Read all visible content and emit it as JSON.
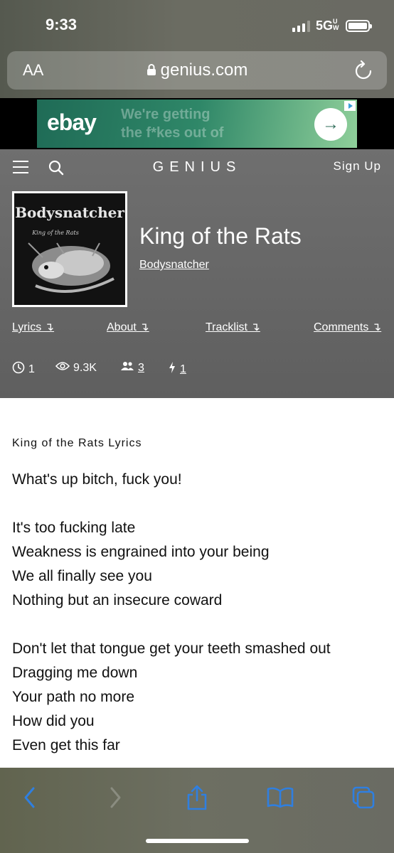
{
  "status_bar": {
    "time": "9:33",
    "network": "5G",
    "network_suffix": "UW"
  },
  "url_bar": {
    "text_size_label": "AA",
    "url": "genius.com"
  },
  "ad": {
    "logo": "ebay",
    "text_line1": "We're getting",
    "text_line2": "the f*kes out of",
    "arrow": "→"
  },
  "header": {
    "logo": "GENIUS",
    "sign_up": "Sign Up",
    "song_title": "King of the Rats",
    "artist": "Bodysnatcher",
    "album_art_text": "Bodysnatcher",
    "album_art_subtitle": "King of the Rats"
  },
  "section_links": [
    {
      "label": "Lyrics ↴"
    },
    {
      "label": "About ↴"
    },
    {
      "label": "Tracklist ↴"
    },
    {
      "label": "Comments ↴"
    }
  ],
  "stats": {
    "clock": "1",
    "views": "9.3K",
    "contributors": "3",
    "bolt": "1"
  },
  "lyrics": {
    "heading": "King of the Rats Lyrics",
    "lines": [
      "What's up bitch, fuck you!",
      "",
      "It's too fucking late",
      "Weakness is engrained into your being",
      "We all finally see you",
      "Nothing but an insecure coward",
      "",
      "Don't let that tongue get your teeth smashed out",
      "Dragging me down",
      "Your path no more",
      "How did you",
      "Even get this far"
    ]
  },
  "colors": {
    "ios_blue": "#2f7fe0",
    "header_gray": "#666666",
    "ad_green": "#2f8768"
  }
}
